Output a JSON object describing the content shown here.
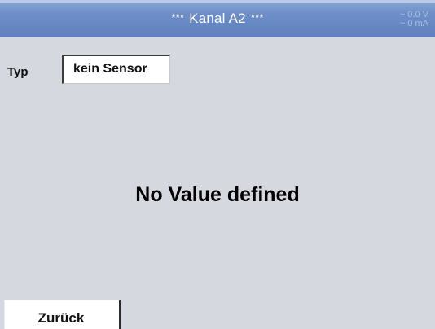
{
  "header": {
    "stars_left": "***",
    "title": "Kanal A2",
    "stars_right": "***",
    "voltage": "~ 0.0 V",
    "current": "~ 0 mA"
  },
  "typ": {
    "label": "Typ",
    "value": "kein Sensor"
  },
  "message": "No Value defined",
  "footer": {
    "back_label": "Zurück"
  },
  "colors": {
    "title_bar": "#6e8fc8",
    "background": "#d5d8de",
    "readout_text": "#a9bfe3"
  }
}
